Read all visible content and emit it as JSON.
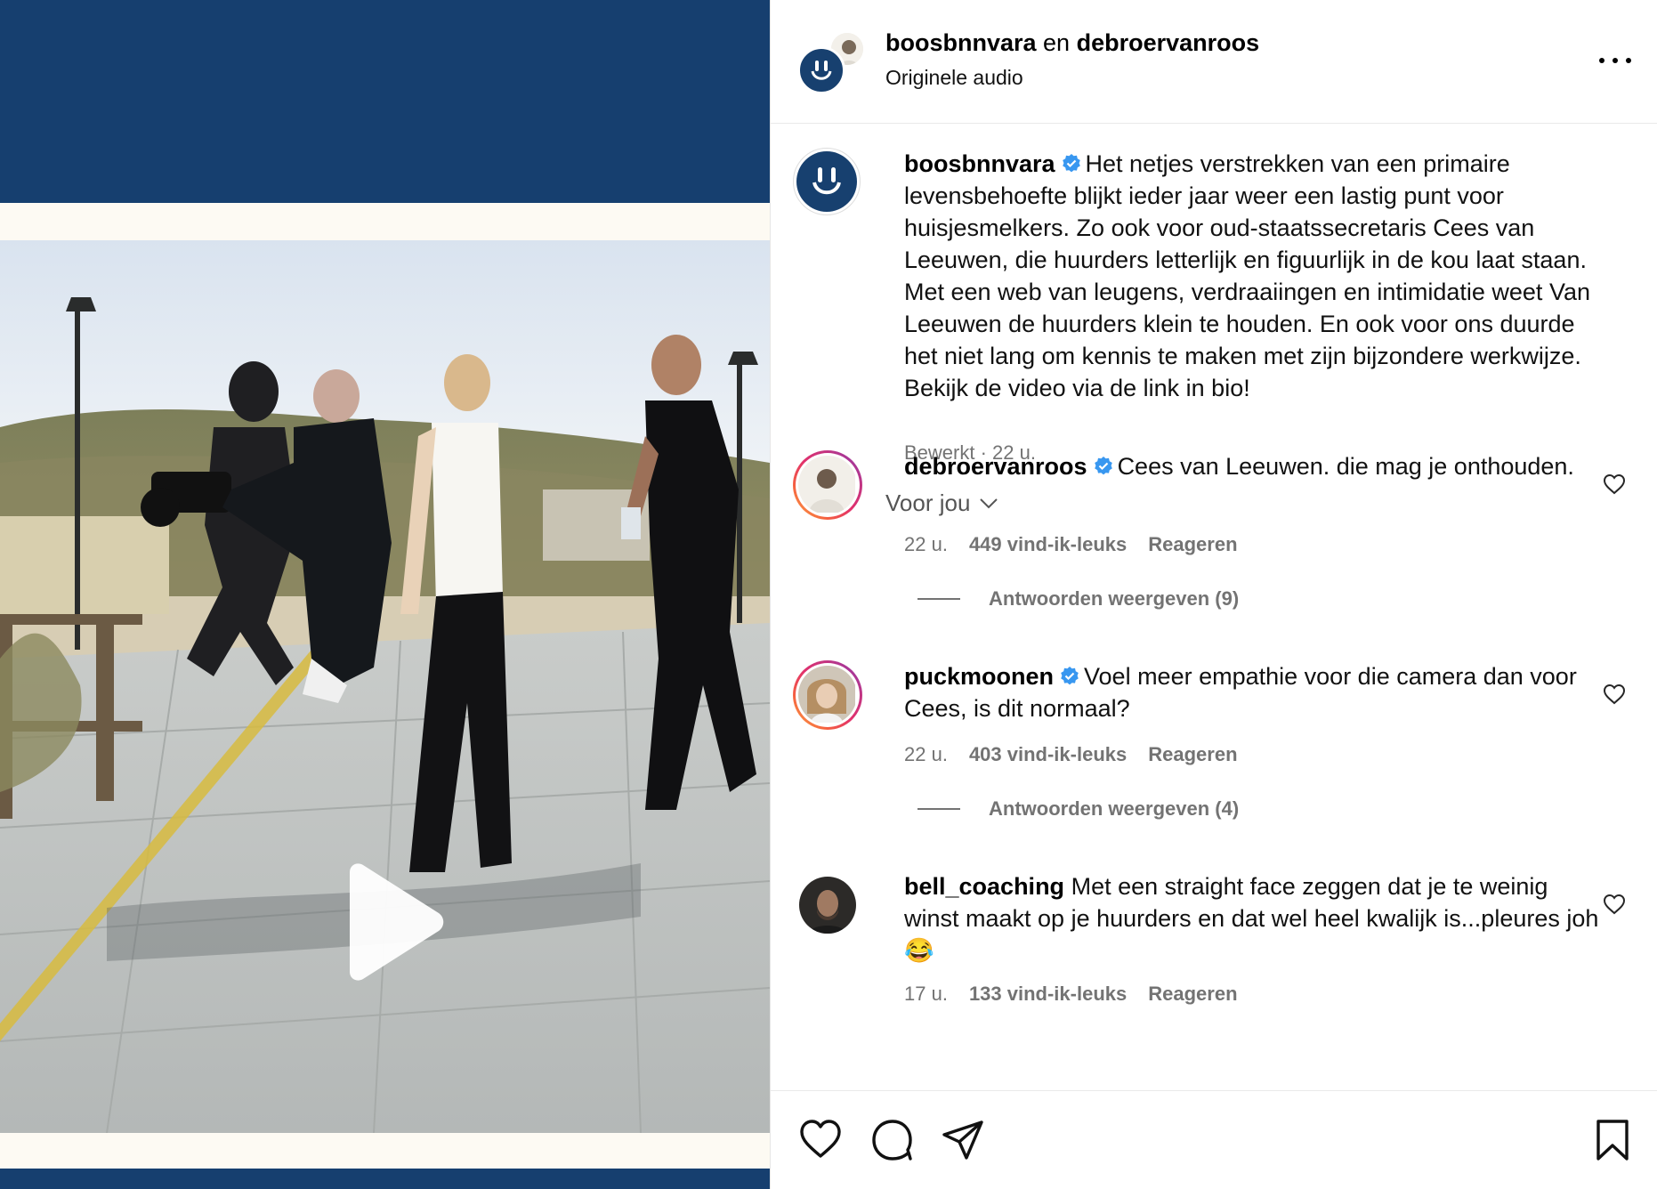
{
  "header": {
    "user1": "boosbnnvara",
    "conjunction": " en ",
    "user2": "debroervanroos",
    "audio": "Originele audio"
  },
  "caption": {
    "username": "boosbnnvara",
    "text": "Het netjes verstrekken van een primaire levensbehoefte blijkt ieder jaar weer een lastig punt voor huisjesmelkers. Zo ook voor oud-staatssecretaris Cees van Leeuwen, die huurders letterlijk en figuurlijk in de kou laat staan. Met een web van leugens, verdraaiingen en intimidatie weet Van Leeuwen de huurders klein te houden. En ook voor ons duurde het niet lang om kennis te maken met zijn bijzondere werkwijze. Bekijk de video via de link in bio!",
    "meta": "Bewerkt · 22 u."
  },
  "sort_label": "Voor jou",
  "comments": [
    {
      "username": "debroervanroos",
      "text": "Cees van Leeuwen. die mag je onthouden.",
      "time": "22 u.",
      "likes": "449 vind-ik-leuks",
      "reply": "Reageren",
      "view_replies": "Antwoorden weergeven (9)"
    },
    {
      "username": "puckmoonen",
      "text": "Voel meer empathie voor die camera dan voor Cees, is dit normaal?",
      "time": "22 u.",
      "likes": "403 vind-ik-leuks",
      "reply": "Reageren",
      "view_replies": "Antwoorden weergeven (4)"
    },
    {
      "username": "bell_coaching",
      "text": "Met een straight face zeggen dat je te weinig winst maakt op je huurders en dat wel heel kwalijk is...pleures joh😂",
      "time": "17 u.",
      "likes": "133 vind-ik-leuks",
      "reply": "Reageren"
    }
  ],
  "colors": {
    "brand_navy": "#163f6f",
    "verified_blue": "#3897f0",
    "muted_text": "#737373"
  },
  "icons": [
    "play-icon",
    "more-icon",
    "verified-icon",
    "chevron-down-icon",
    "heart-icon",
    "comment-icon",
    "share-icon",
    "bookmark-icon"
  ]
}
